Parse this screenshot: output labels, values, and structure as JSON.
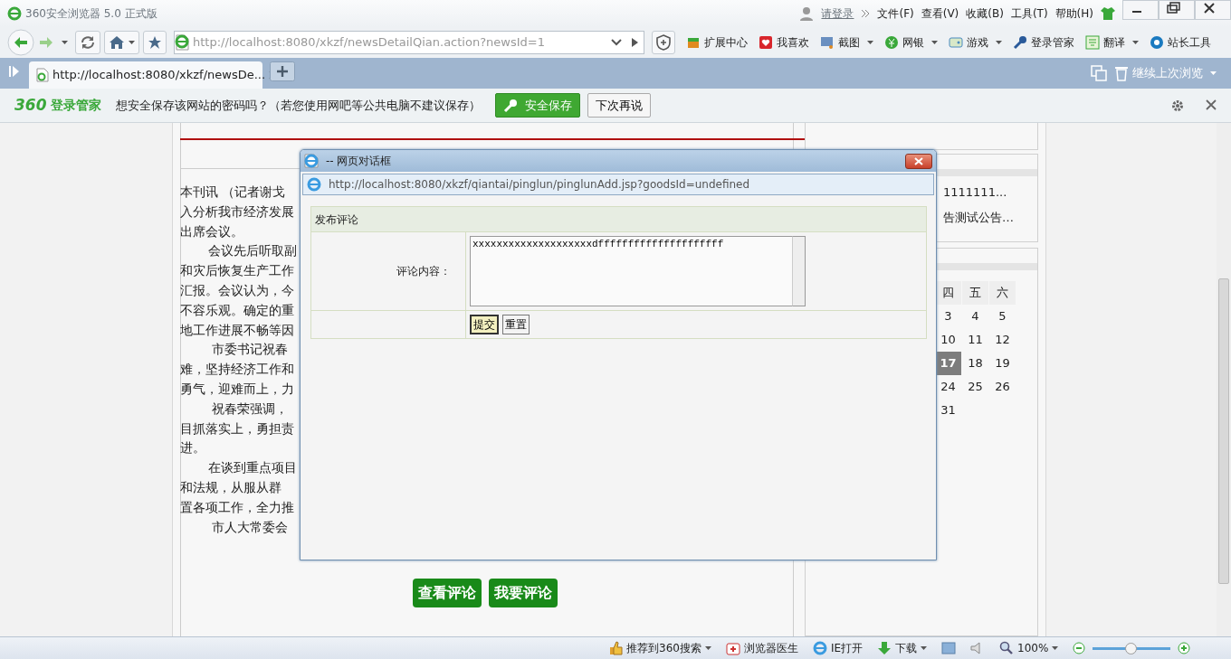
{
  "window": {
    "title": "360安全浏览器 5.0 正式版"
  },
  "account": {
    "label": "请登录"
  },
  "menu": [
    "文件(F)",
    "查看(V)",
    "收藏(B)",
    "工具(T)",
    "帮助(H)"
  ],
  "address": "http://localhost:8080/xkzf/newsDetailQian.action?newsId=1",
  "extensions": [
    {
      "label": "扩展中心",
      "dropdown": false
    },
    {
      "label": "我喜欢",
      "dropdown": false
    },
    {
      "label": "截图",
      "dropdown": true
    },
    {
      "label": "网银",
      "dropdown": true
    },
    {
      "label": "游戏",
      "dropdown": true
    },
    {
      "label": "登录管家",
      "dropdown": false
    },
    {
      "label": "翻译",
      "dropdown": true
    },
    {
      "label": "站长工具",
      "dropdown": false
    }
  ],
  "tabs": [
    {
      "label": "http://localhost:8080/xkzf/newsDe...",
      "selected": true
    }
  ],
  "restore_label": "继续上次浏览",
  "notification": {
    "brand": "360",
    "brand_text": "登录管家",
    "message": "想安全保存该网站的密码吗？（若您使用网吧等公共电脑不建议保存）",
    "primary_button": "安全保存",
    "secondary_button": "下次再说"
  },
  "article": {
    "lines": [
      {
        "text": "本刊讯 （记者谢戈",
        "indent": false
      },
      {
        "text": "入分析我市经济发展",
        "indent": false
      },
      {
        "text": "出席会议。",
        "indent": false
      },
      {
        "text": "会议先后听取副",
        "indent": true
      },
      {
        "text": "和灾后恢复生产工作",
        "indent": false
      },
      {
        "text": "汇报。会议认为，今",
        "indent": false
      },
      {
        "text": "不容乐观。确定的重",
        "indent": false
      },
      {
        "text": "地工作进展不畅等因",
        "indent": false
      },
      {
        "text": "市委书记祝春",
        "indent": true
      },
      {
        "text": "难，坚持经济工作和",
        "indent": false
      },
      {
        "text": "勇气，迎难而上，力",
        "indent": false
      },
      {
        "text": "祝春荣强调，",
        "indent": true
      },
      {
        "text": "目抓落实上，勇担责",
        "indent": false
      },
      {
        "text": "进。",
        "indent": false
      },
      {
        "text": "在谈到重点项目",
        "indent": true
      },
      {
        "text": "和法规，从服从群",
        "indent": false
      },
      {
        "text": "置各项工作，全力推",
        "indent": false
      },
      {
        "text": "市人大常委会",
        "indent": true
      }
    ]
  },
  "action_buttons": [
    "查看评论",
    "我要评论"
  ],
  "sidebar": {
    "notices": [
      "1111111...",
      "告测试公告…"
    ],
    "calendar": {
      "weekdays": [
        "四",
        "五",
        "六"
      ],
      "weeks": [
        [
          {
            "day": "3",
            "selected": false
          },
          {
            "day": "4",
            "selected": false
          },
          {
            "day": "5",
            "selected": false
          }
        ],
        [
          {
            "day": "10",
            "selected": false
          },
          {
            "day": "11",
            "selected": false
          },
          {
            "day": "12",
            "selected": false
          }
        ],
        [
          {
            "day": "17",
            "selected": true
          },
          {
            "day": "18",
            "selected": false
          },
          {
            "day": "19",
            "selected": false
          }
        ],
        [
          {
            "day": "24",
            "selected": false
          },
          {
            "day": "25",
            "selected": false
          },
          {
            "day": "26",
            "selected": false
          }
        ],
        [
          {
            "day": "31",
            "selected": false
          }
        ]
      ]
    }
  },
  "dialog": {
    "title": "-- 网页对话框",
    "url": "http://localhost:8080/xkzf/qiantai/pinglun/pinglunAdd.jsp?goodsId=undefined",
    "form": {
      "heading": "发布评论",
      "label": "评论内容：",
      "value": "xxxxxxxxxxxxxxxxxxxxdfffffffffffffffffffff",
      "buttons": [
        {
          "label": "提交",
          "focused": true
        },
        {
          "label": "重置",
          "focused": false
        }
      ]
    }
  },
  "status_bar": {
    "items": [
      {
        "label": "推荐到360搜索",
        "dropdown": true,
        "kind": "thumb"
      },
      {
        "label": "浏览器医生",
        "dropdown": false,
        "kind": "medkit"
      },
      {
        "label": "IE打开",
        "dropdown": false,
        "kind": "ie"
      },
      {
        "label": "下载",
        "dropdown": true,
        "kind": "download"
      }
    ],
    "zoom": {
      "label": "100%",
      "level": 0.49
    }
  }
}
